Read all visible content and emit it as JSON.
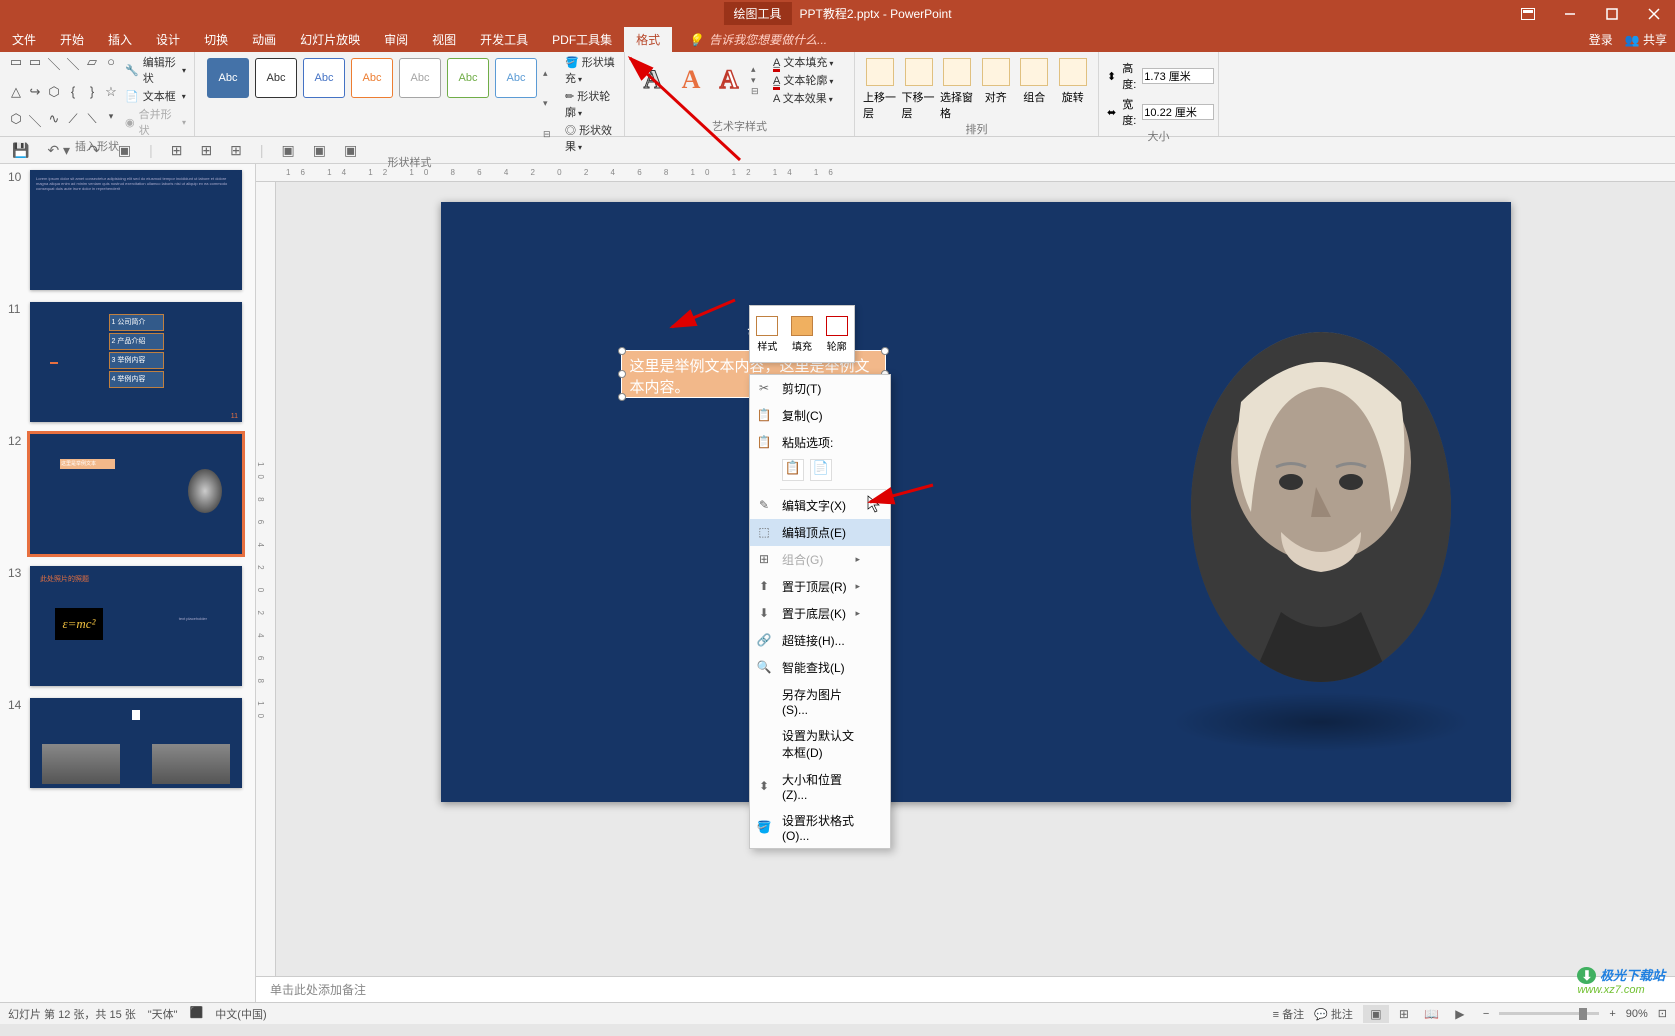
{
  "title": {
    "context_tab": "绘图工具",
    "doc_name": "PPT教程2.pptx - PowerPoint"
  },
  "tabs": {
    "file": "文件",
    "home": "开始",
    "insert": "插入",
    "design": "设计",
    "transition": "切换",
    "animation": "动画",
    "slideshow": "幻灯片放映",
    "review": "审阅",
    "view": "视图",
    "developer": "开发工具",
    "pdf_tools": "PDF工具集",
    "format": "格式",
    "tell_me": "告诉我您想要做什么...",
    "login": "登录",
    "share": "共享"
  },
  "ribbon": {
    "group_insert_shapes": "插入形状",
    "group_shape_styles": "形状样式",
    "group_wordart": "艺术字样式",
    "group_arrange": "排列",
    "group_size": "大小",
    "edit_shape": "编辑形状",
    "text_box": "文本框",
    "merge_shape": "合并形状",
    "swatch_label": "Abc",
    "shape_fill": "形状填充",
    "shape_outline": "形状轮廓",
    "shape_effects": "形状效果",
    "text_fill": "文本填充",
    "text_outline": "文本轮廓",
    "text_effects": "文本效果",
    "bring_forward": "上移一层",
    "send_backward": "下移一层",
    "selection_pane": "选择窗格",
    "align": "对齐",
    "group": "组合",
    "rotate": "旋转",
    "height_label": "高度:",
    "height_value": "1.73 厘米",
    "width_label": "宽度:",
    "width_value": "10.22 厘米"
  },
  "mini_toolbar": {
    "style": "样式",
    "fill": "填充",
    "outline": "轮廓"
  },
  "context_menu": {
    "cut": "剪切(T)",
    "copy": "复制(C)",
    "paste_options": "粘贴选项:",
    "edit_text": "编辑文字(X)",
    "edit_points": "编辑顶点(E)",
    "group": "组合(G)",
    "bring_to_front": "置于顶层(R)",
    "send_to_back": "置于底层(K)",
    "hyperlink": "超链接(H)...",
    "smart_lookup": "智能查找(L)",
    "save_as_picture": "另存为图片(S)...",
    "set_as_default": "设置为默认文本框(D)",
    "size_position": "大小和位置(Z)...",
    "format_shape": "设置形状格式(O)..."
  },
  "slide": {
    "text_content": "这里是举例文本内容，这里是举例文本内容。"
  },
  "thumbs": {
    "slide_10": "10",
    "slide_11": "11",
    "slide_12": "12",
    "slide_13": "13",
    "slide_14": "14",
    "s11_box1": "1 公司简介",
    "s11_box2": "2 产品介绍",
    "s11_box3": "3 举例内容",
    "s11_box4": "4 举例内容",
    "s13_title": "此处照片的照题",
    "s13_formula": "ε=mc²"
  },
  "notes": {
    "placeholder": "单击此处添加备注"
  },
  "status": {
    "slide_info": "幻灯片 第 12 张，共 15 张",
    "font": "\"天体\"",
    "lang": "中文(中国)",
    "notes_btn": "备注",
    "comments_btn": "批注",
    "zoom": "90%"
  },
  "watermark": {
    "line1": "极光下载站",
    "line2": "www.xz7.com"
  },
  "colors": {
    "accent": "#b7472a",
    "slide_bg": "#163566",
    "shape_bg": "#f2b88a",
    "selection": "#e77040"
  }
}
